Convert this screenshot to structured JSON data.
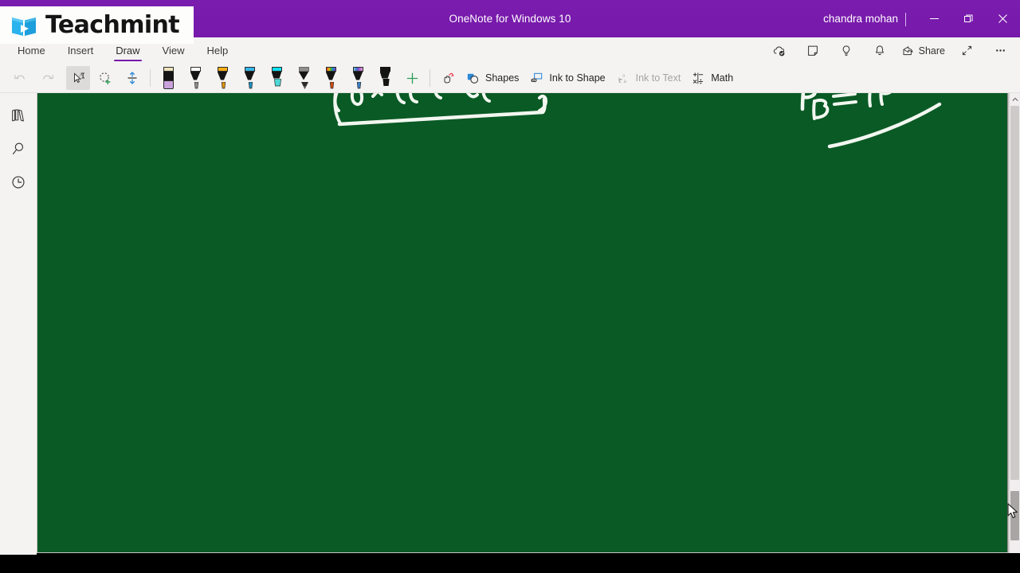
{
  "window": {
    "title": "OneNote for Windows 10",
    "user": "chandra mohan",
    "controls": {
      "minimize": "─",
      "restore": "❐",
      "close": "✕"
    }
  },
  "brand": {
    "name": "Teachmint",
    "logo_icon": "open-book-play-icon",
    "colors": {
      "book": "#2bb3ee",
      "book_dark": "#1d9fdd",
      "text": "#151515"
    }
  },
  "menu": {
    "tabs": [
      {
        "label": "Home",
        "active": false
      },
      {
        "label": "Insert",
        "active": false
      },
      {
        "label": "Draw",
        "active": true
      },
      {
        "label": "View",
        "active": false
      },
      {
        "label": "Help",
        "active": false
      }
    ],
    "right_actions": [
      {
        "label": "",
        "icon": "cloud-sync-icon"
      },
      {
        "label": "",
        "icon": "sticky-note-icon"
      },
      {
        "label": "",
        "icon": "lightbulb-icon"
      },
      {
        "label": "",
        "icon": "bell-icon"
      },
      {
        "label": "Share",
        "icon": "share-icon"
      },
      {
        "label": "",
        "icon": "expand-diagonal-icon"
      },
      {
        "label": "",
        "icon": "ellipsis-icon"
      }
    ]
  },
  "ribbon": {
    "history": [
      {
        "name": "undo",
        "icon": "undo-arrow-icon",
        "disabled": true
      },
      {
        "name": "redo",
        "icon": "redo-arrow-icon",
        "disabled": true
      }
    ],
    "selectors": [
      {
        "name": "select-object",
        "icon": "select-object-icon",
        "selected": true
      },
      {
        "name": "lasso-select",
        "icon": "lasso-select-icon",
        "selected": false
      },
      {
        "name": "insert-space",
        "icon": "insert-space-icon",
        "selected": false
      }
    ],
    "pens": [
      {
        "name": "eraser",
        "icon": "eraser-icon",
        "cap": "#ece3bd",
        "body": "#141414",
        "tip": "#c9a2dc",
        "type": "eraser"
      },
      {
        "name": "pen-black",
        "icon": "pen-icon",
        "cap": "#ffffff",
        "body": "#141414",
        "tip": "#8c8c8c",
        "type": "pen"
      },
      {
        "name": "pen-yellow",
        "icon": "pen-icon",
        "cap": "#f6ad16",
        "body": "#141414",
        "tip": "#d9920d",
        "type": "pen"
      },
      {
        "name": "pen-blue",
        "icon": "pen-icon",
        "cap": "#37b5e8",
        "body": "#141414",
        "tip": "#1d8fbd",
        "type": "pen"
      },
      {
        "name": "highlighter-cyan",
        "icon": "highlighter-icon",
        "cap": "#0fe0ef",
        "body": "#141414",
        "tip": "#4fd6d6",
        "type": "marker"
      },
      {
        "name": "pencil-grey",
        "icon": "pencil-icon",
        "cap": "#8e8e8e",
        "body": "#141414",
        "tip": "#5a5a5a",
        "type": "pencil"
      },
      {
        "name": "pen-rainbow",
        "icon": "rainbow-pen-icon",
        "cap": "rainbow",
        "body": "#141414",
        "tip": "#cc4a12",
        "type": "pen"
      },
      {
        "name": "pen-rainbow-blue",
        "icon": "rainbow-pen-icon",
        "cap": "rainbow-blue",
        "body": "#141414",
        "tip": "#3a7fc4",
        "type": "pen"
      },
      {
        "name": "marker-black",
        "icon": "marker-icon",
        "cap": "#141414",
        "body": "#141414",
        "tip": "#141414",
        "type": "marker"
      }
    ],
    "add_pen": {
      "name": "add-pen",
      "icon": "plus-icon",
      "color": "#2e9e55"
    },
    "tools": [
      {
        "name": "ink-gesture",
        "label": "",
        "icon": "ink-gesture-icon",
        "disabled": false
      },
      {
        "name": "shapes",
        "label": "Shapes",
        "icon": "shapes-icon",
        "disabled": false
      },
      {
        "name": "ink-to-shape",
        "label": "Ink to Shape",
        "icon": "ink-to-shape-icon",
        "disabled": false
      },
      {
        "name": "ink-to-text",
        "label": "Ink to Text",
        "icon": "ink-to-text-icon",
        "disabled": true
      },
      {
        "name": "math",
        "label": "Math",
        "icon": "math-icon",
        "disabled": false
      }
    ]
  },
  "rail": {
    "items": [
      {
        "name": "notebooks",
        "icon": "notebooks-icon"
      },
      {
        "name": "search",
        "icon": "search-icon"
      },
      {
        "name": "recent-edits",
        "icon": "clock-icon"
      }
    ]
  },
  "canvas": {
    "background_color": "#0a5a25",
    "ink_color": "#f2f7f0",
    "description": "handwritten whiteboard ink, scrolled so strokes are cut off at the top edge",
    "notes": [
      {
        "name": "ink-stroke-left-formula",
        "text": "partially visible handwriting with long underline bracket"
      },
      {
        "name": "ink-stroke-right-formula",
        "text": "P B ="
      }
    ]
  },
  "scrollbar": {
    "up_arrow": "⌃",
    "down_arrow": "⌄"
  }
}
